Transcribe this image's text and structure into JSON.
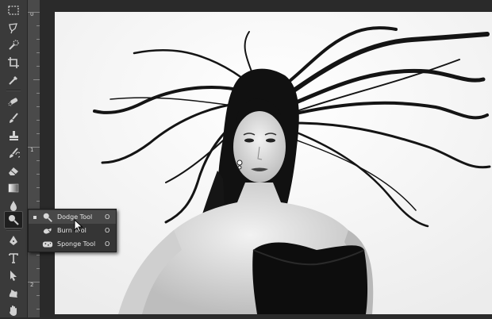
{
  "ruler": {
    "labels": [
      "0",
      "1",
      "2"
    ]
  },
  "toolbar": {
    "tools": [
      {
        "name": "rectangular-marquee-icon"
      },
      {
        "name": "lasso-icon"
      },
      {
        "name": "quick-selection-icon"
      },
      {
        "name": "crop-icon"
      },
      {
        "name": "eyedropper-icon"
      },
      {
        "name": "spot-healing-brush-icon"
      },
      {
        "name": "brush-icon"
      },
      {
        "name": "clone-stamp-icon"
      },
      {
        "name": "history-brush-icon"
      },
      {
        "name": "eraser-icon"
      },
      {
        "name": "gradient-icon"
      },
      {
        "name": "blur-icon"
      },
      {
        "name": "dodge-icon"
      },
      {
        "name": "pen-icon"
      },
      {
        "name": "type-icon"
      },
      {
        "name": "path-selection-icon"
      },
      {
        "name": "custom-shape-icon"
      },
      {
        "name": "hand-icon"
      }
    ]
  },
  "flyout": {
    "items": [
      {
        "label": "Dodge Tool",
        "shortcut": "O",
        "icon": "dodge-icon",
        "selected": true
      },
      {
        "label": "Burn Tool",
        "shortcut": "O",
        "icon": "burn-icon",
        "selected": false
      },
      {
        "label": "Sponge Tool",
        "shortcut": "O",
        "icon": "sponge-icon",
        "selected": false
      }
    ]
  },
  "colors": {
    "toolbar_bg": "#3a3a3a",
    "flyout_bg": "#353535",
    "canvas_bg": "#fdfdfd"
  }
}
